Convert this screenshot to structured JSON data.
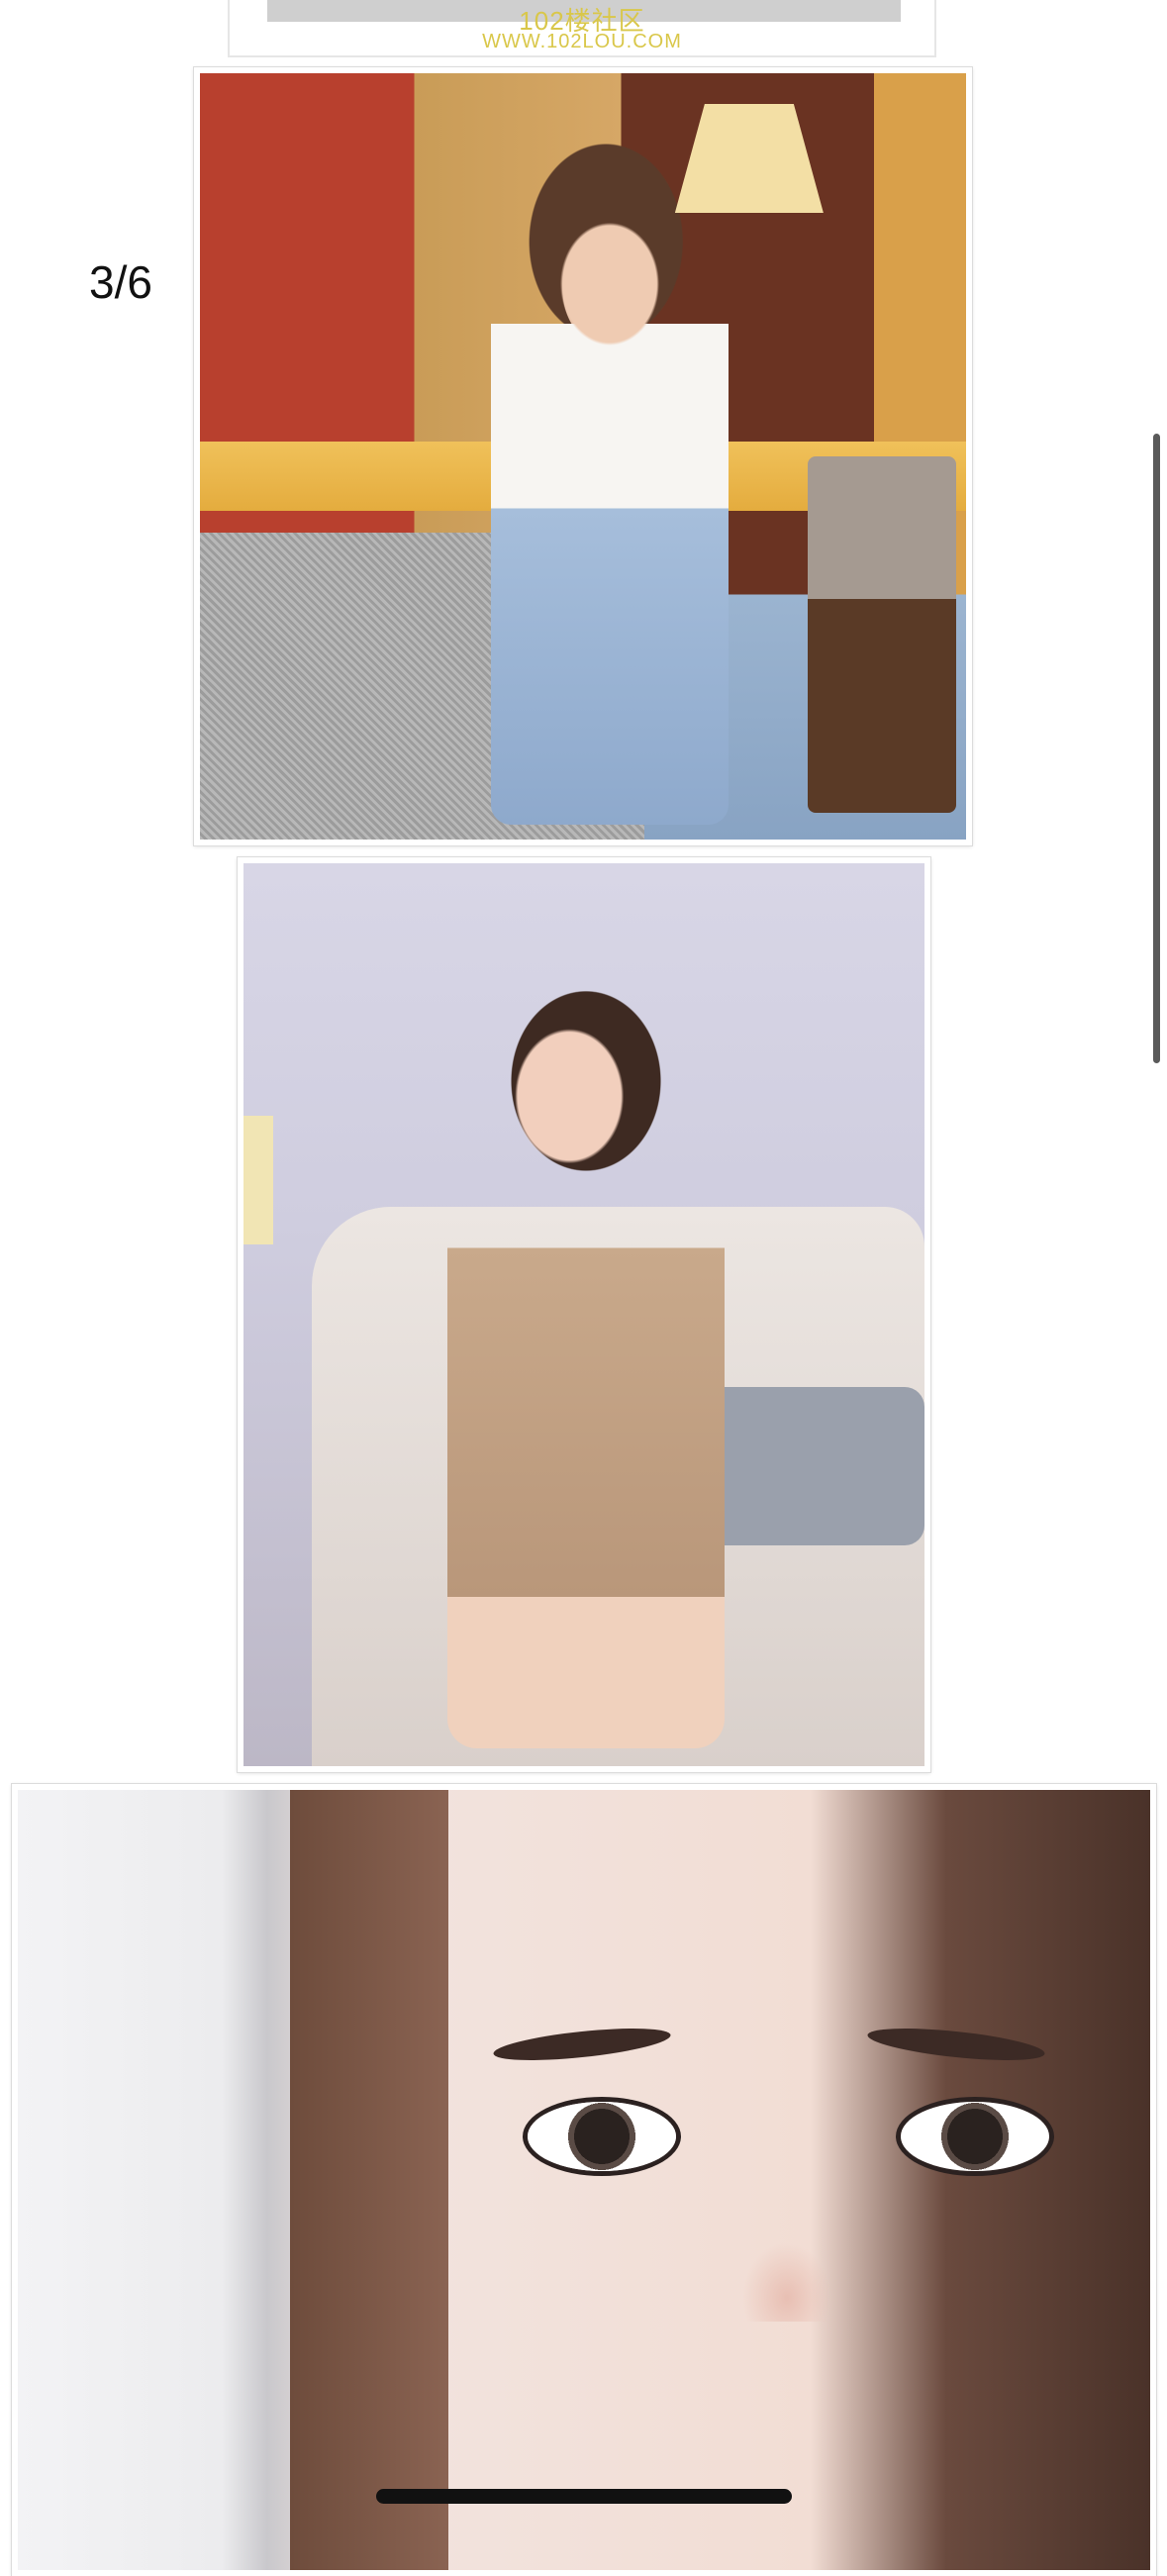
{
  "watermark": {
    "line1": "102楼社区",
    "line2": "WWW.102LOU.COM"
  },
  "page_counter": "3/6",
  "photos": [
    {
      "name": "photo-bar-scene"
    },
    {
      "name": "photo-sofa-scene"
    },
    {
      "name": "photo-face-closeup"
    }
  ],
  "colors": {
    "background": "#ffffff",
    "watermark": "#d9c74a",
    "scrollbar": "#5a5a5a",
    "home_indicator": "#111111"
  }
}
